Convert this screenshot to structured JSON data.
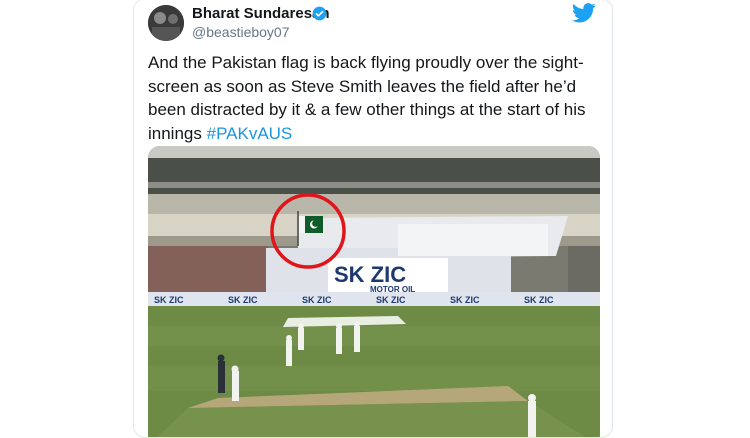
{
  "tweet": {
    "author_name": "Bharat Sundaresan",
    "author_handle": "@beastieboy07",
    "text_main": "And the Pakistan flag is back flying proudly over the sight-screen as soon as Steve Smith leaves the field after he’d been distracted by it & a few other things at the start of his innings",
    "hashtag": "#PAKvAUS"
  },
  "media": {
    "billboard_brand": "SK ZIC",
    "billboard_sub": "MOTOR OIL",
    "boundary_ad": "SK ZIC",
    "highlight_color": "#e0141a"
  },
  "icons": {
    "verified": "verified-badge-icon",
    "platform": "twitter-bird-icon"
  }
}
